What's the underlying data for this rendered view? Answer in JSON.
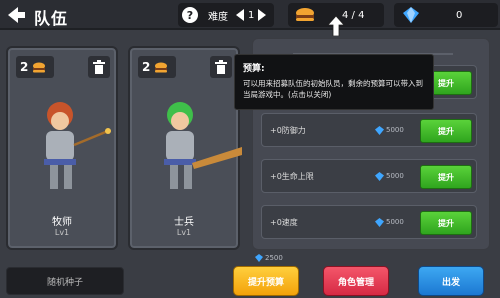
{
  "header": {
    "title": "队伍",
    "difficulty_label": "难度",
    "difficulty_value": "1",
    "budget_value": "4 / 4",
    "gems_value": "0"
  },
  "units": [
    {
      "cost": "2",
      "name": "牧师",
      "level": "Lv1"
    },
    {
      "cost": "2",
      "name": "士兵",
      "level": "Lv1"
    }
  ],
  "tooltip": {
    "title": "预算:",
    "body": "可以用来招募队伍的初始队员，剩余的预算可以带入到当局游戏中。(点击以关闭)"
  },
  "upgrades": [
    {
      "label": "",
      "cost": "",
      "button": "提升"
    },
    {
      "label": "+0防御力",
      "cost": "5000",
      "button": "提升"
    },
    {
      "label": "+0生命上限",
      "cost": "5000",
      "button": "提升"
    },
    {
      "label": "+0速度",
      "cost": "5000",
      "button": "提升"
    }
  ],
  "footer": {
    "seed_label": "随机种子",
    "upgrade_cost": "2500",
    "upgrade_budget": "提升预算",
    "role_manage": "角色管理",
    "start": "出发"
  },
  "colors": {
    "upgrade_green": "#3ec12a",
    "budget_yellow": "#f7b418",
    "role_red": "#e53a52",
    "start_blue": "#2a8ee2",
    "gem_blue": "#3fa6ff"
  }
}
